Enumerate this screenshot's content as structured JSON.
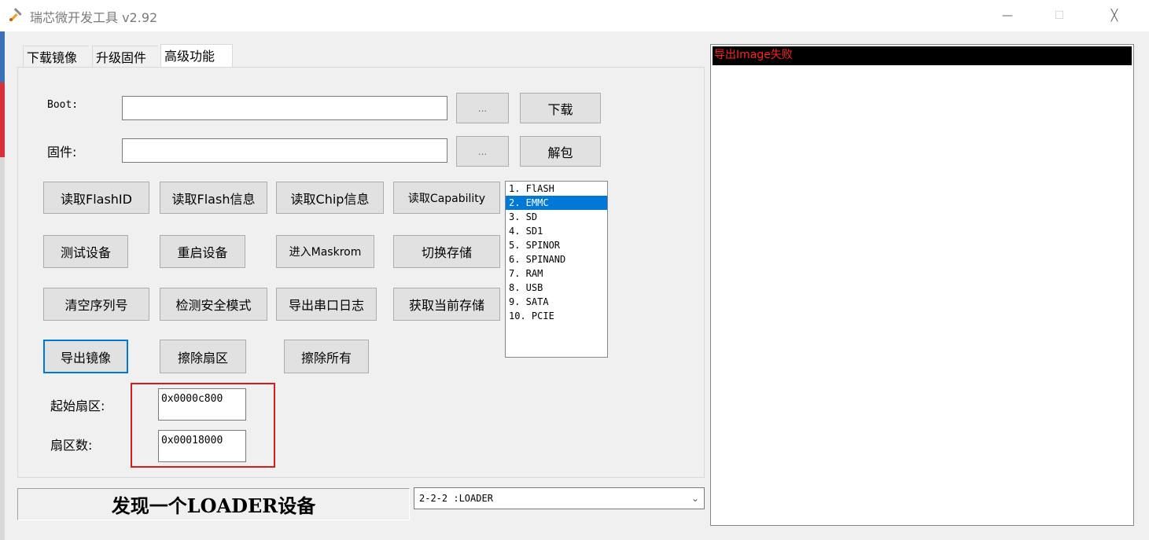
{
  "window": {
    "title": "瑞芯微开发工具 v2.92",
    "minimize_glyph": "—",
    "maximize_glyph": "☐",
    "close_glyph": "╳"
  },
  "tabs": [
    {
      "label": "下载镜像"
    },
    {
      "label": "升级固件"
    },
    {
      "label": "高级功能"
    }
  ],
  "advanced": {
    "boot_label": "Boot:",
    "boot_value": "",
    "boot_browse": "...",
    "boot_download": "下载",
    "firmware_label": "固件:",
    "firmware_value": "",
    "firmware_browse": "...",
    "firmware_unpack": "解包",
    "buttons": {
      "read_flash_id": "读取FlashID",
      "read_flash_info": "读取Flash信息",
      "read_chip_info": "读取Chip信息",
      "read_capability": "读取Capability",
      "test_device": "测试设备",
      "reboot_device": "重启设备",
      "enter_maskrom": "进入Maskrom",
      "switch_storage": "切换存储",
      "clear_serial": "清空序列号",
      "check_secure_mode": "检测安全模式",
      "export_serial_log": "导出串口日志",
      "get_current_storage": "获取当前存储",
      "export_image": "导出镜像",
      "erase_sectors": "擦除扇区",
      "erase_all": "擦除所有"
    },
    "storage_list": [
      "1. FlASH",
      "2. EMMC",
      "3. SD",
      "4. SD1",
      "5. SPINOR",
      "6. SPINAND",
      "7. RAM",
      "8. USB",
      "9. SATA",
      "10. PCIE"
    ],
    "storage_selected_index": 1,
    "start_sector_label": "起始扇区:",
    "start_sector_value": "0x0000c800",
    "sector_count_label": "扇区数:",
    "sector_count_value": "0x00018000"
  },
  "status": {
    "message": "发现一个LOADER设备",
    "device_selected": "2-2-2 :LOADER"
  },
  "log": {
    "lines": [
      "导出Image失败"
    ]
  },
  "colors": {
    "selection": "#0078d7",
    "log_error": "#ff2020",
    "highlight_box": "#d21d1d"
  }
}
